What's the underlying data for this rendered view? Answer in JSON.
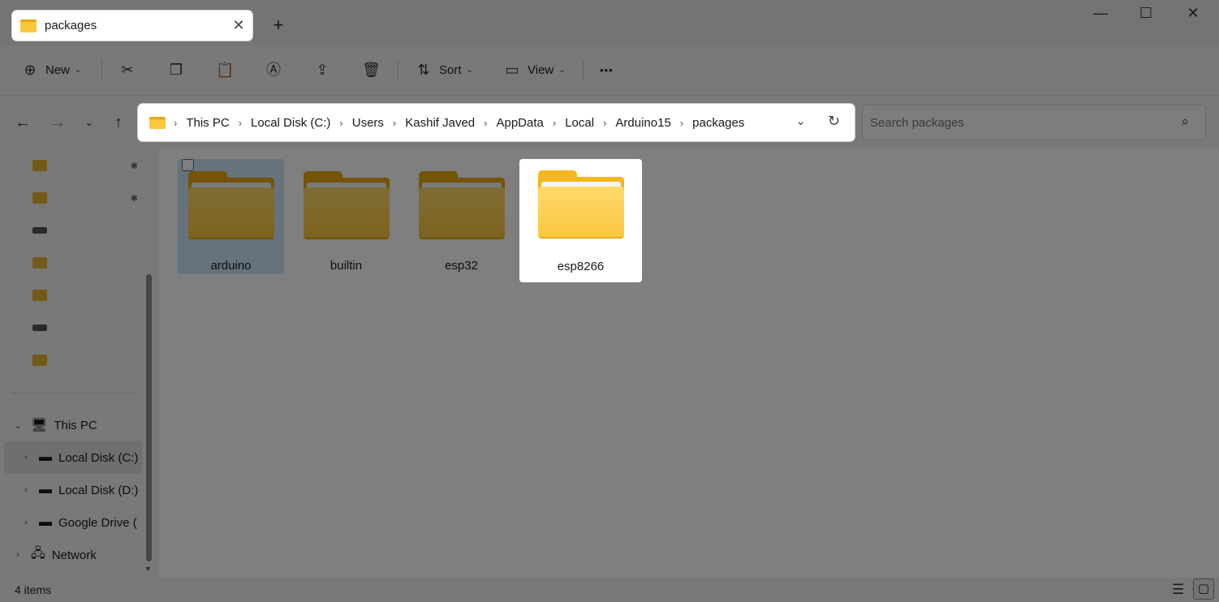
{
  "tab": {
    "title": "packages",
    "close": "✕",
    "new_tab": "+"
  },
  "window_controls": {
    "minimize": "—",
    "maximize": "☐",
    "close": "✕"
  },
  "toolbar": {
    "new_label": "New",
    "sort_label": "Sort",
    "view_label": "View",
    "more_label": "•••"
  },
  "address": {
    "crumbs": [
      "This PC",
      "Local Disk (C:)",
      "Users",
      "Kashif Javed",
      "AppData",
      "Local",
      "Arduino15",
      "packages"
    ]
  },
  "search": {
    "placeholder": "Search packages"
  },
  "sidebar": {
    "tree": [
      {
        "label": "This PC"
      },
      {
        "label": "Local Disk (C:)"
      },
      {
        "label": "Local Disk (D:)"
      },
      {
        "label": "Google Drive ("
      },
      {
        "label": "Network"
      }
    ]
  },
  "folders": [
    {
      "name": "arduino"
    },
    {
      "name": "builtin"
    },
    {
      "name": "esp32"
    },
    {
      "name": "esp8266"
    }
  ],
  "status": {
    "count": "4 items"
  },
  "colors": {
    "folder": "#fbc73e",
    "selection": "#cfe6f8",
    "dim_overlay": "rgba(0,0,0,0.5)"
  }
}
